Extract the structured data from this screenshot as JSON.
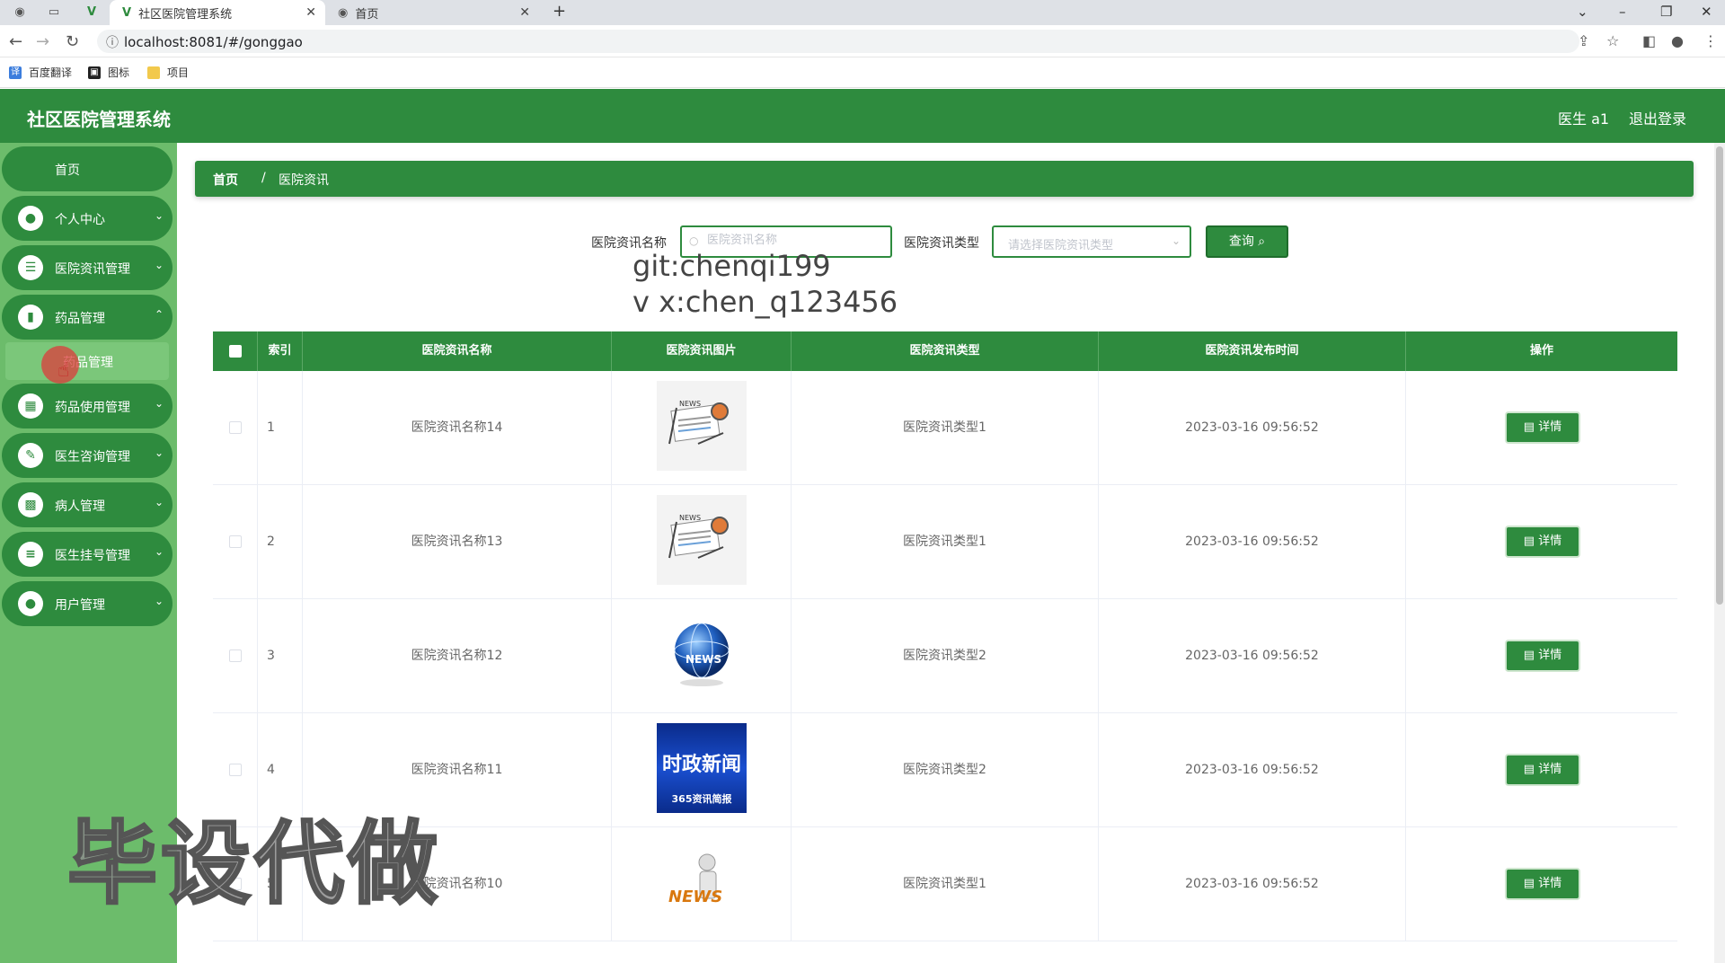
{
  "browser": {
    "tabs": [
      {
        "title": "社区医院管理系统",
        "active": true
      },
      {
        "title": "首页",
        "active": false
      }
    ],
    "url": "localhost:8081/#/gonggao",
    "bookmarks": [
      "百度翻译",
      "图标",
      "项目"
    ]
  },
  "header": {
    "title": "社区医院管理系统",
    "user": "医生 a1",
    "logout": "退出登录"
  },
  "sidebar": {
    "home": "首页",
    "items": [
      {
        "label": "个人中心",
        "icon": "user-icon"
      },
      {
        "label": "医院资讯管理",
        "icon": "sliders-icon"
      },
      {
        "label": "药品管理",
        "icon": "bar-chart-icon"
      },
      {
        "label": "药品使用管理",
        "icon": "grid-icon"
      },
      {
        "label": "医生咨询管理",
        "icon": "chat-icon"
      },
      {
        "label": "病人管理",
        "icon": "apps-icon"
      },
      {
        "label": "医生挂号管理",
        "icon": "list-icon"
      },
      {
        "label": "用户管理",
        "icon": "user-icon"
      }
    ],
    "sub_item": "药品管理"
  },
  "breadcrumb": {
    "home": "首页",
    "separator": "/",
    "current": "医院资讯"
  },
  "search": {
    "name_label": "医院资讯名称",
    "name_placeholder": "医院资讯名称",
    "type_label": "医院资讯类型",
    "type_placeholder": "请选择医院资讯类型",
    "query_button": "查询"
  },
  "watermark": {
    "line1": "git:chenqi199",
    "line2": "v x:chen_q123456",
    "big": "毕设代做"
  },
  "table": {
    "columns": [
      "索引",
      "医院资讯名称",
      "医院资讯图片",
      "医院资讯类型",
      "医院资讯发布时间",
      "操作"
    ],
    "rows": [
      {
        "index": "1",
        "name": "医院资讯名称14",
        "image": "news-paper-icon",
        "type": "医院资讯类型1",
        "time": "2023-03-16 09:56:52",
        "action": "详情"
      },
      {
        "index": "2",
        "name": "医院资讯名称13",
        "image": "news-paper-icon",
        "type": "医院资讯类型1",
        "time": "2023-03-16 09:56:52",
        "action": "详情"
      },
      {
        "index": "3",
        "name": "医院资讯名称12",
        "image": "news-globe-icon",
        "type": "医院资讯类型2",
        "time": "2023-03-16 09:56:52",
        "action": "详情"
      },
      {
        "index": "4",
        "name": "医院资讯名称11",
        "image": "news-banner-image",
        "type": "医院资讯类型2",
        "time": "2023-03-16 09:56:52",
        "action": "详情"
      },
      {
        "index": "5",
        "name": "医院资讯名称10",
        "image": "news-figure-icon",
        "type": "医院资讯类型1",
        "time": "2023-03-16 09:56:52",
        "action": "详情"
      }
    ],
    "banner_text_1": "时政新闻",
    "banner_text_2": "365资讯简报",
    "news_word": "NEWS"
  },
  "colors": {
    "primary": "#2e8b3e",
    "sidebar_bg": "#6cbc6b"
  }
}
